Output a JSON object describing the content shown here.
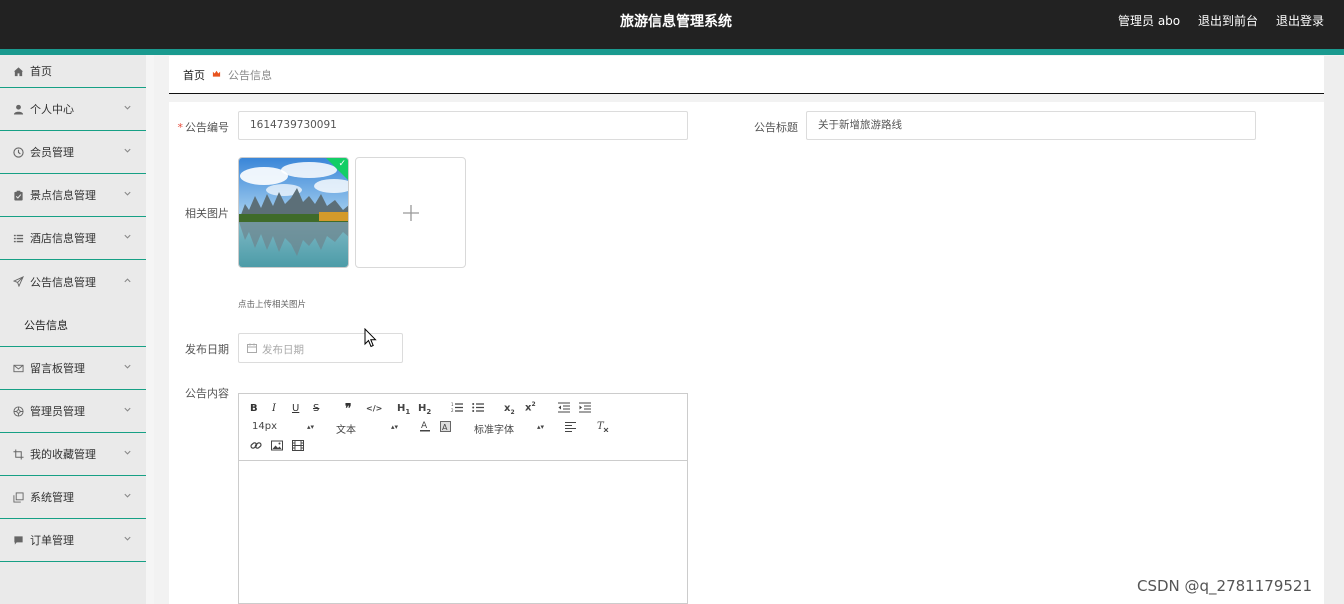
{
  "header": {
    "title": "旅游信息管理系统",
    "user_label": "管理员 abo",
    "front_link": "退出到前台",
    "logout_link": "退出登录"
  },
  "sidebar": {
    "items": [
      {
        "label": "首页",
        "icon": "home-icon"
      },
      {
        "label": "个人中心",
        "icon": "user-icon"
      },
      {
        "label": "会员管理",
        "icon": "clock-icon"
      },
      {
        "label": "景点信息管理",
        "icon": "clipboard-icon"
      },
      {
        "label": "酒店信息管理",
        "icon": "list-icon"
      },
      {
        "label": "公告信息管理",
        "icon": "send-icon"
      },
      {
        "label": "留言板管理",
        "icon": "mail-icon"
      },
      {
        "label": "管理员管理",
        "icon": "target-icon"
      },
      {
        "label": "我的收藏管理",
        "icon": "crop-icon"
      },
      {
        "label": "系统管理",
        "icon": "copy-icon"
      },
      {
        "label": "订单管理",
        "icon": "chat-icon"
      }
    ],
    "submenu": {
      "label": "公告信息"
    }
  },
  "breadcrumb": {
    "home": "首页",
    "current": "公告信息"
  },
  "form": {
    "number_label": "公告编号",
    "number_value": "1614739730091",
    "title_label": "公告标题",
    "title_value": "关于新增旅游路线",
    "image_label": "相关图片",
    "upload_hint": "点击上传相关图片",
    "date_label": "发布日期",
    "date_placeholder": "发布日期",
    "content_label": "公告内容"
  },
  "editor": {
    "size": "14px",
    "block": "文本",
    "font": "标准字体"
  },
  "colors": {
    "header_bg": "#222222",
    "accent": "#1a9a8f",
    "required": "#e74c3c"
  },
  "watermark": "CSDN @q_2781179521"
}
